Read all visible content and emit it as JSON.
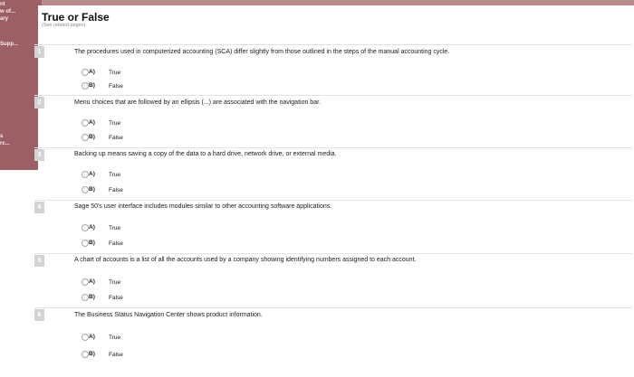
{
  "sidebar": {
    "items": [
      "nt",
      "w of...",
      "ary",
      "Supp...",
      "s",
      "rc..."
    ]
  },
  "header": {
    "title": "True or False",
    "subtitle": "(See related pages)"
  },
  "questions": [
    {
      "num": "1",
      "text": "The procedures used in computerized accounting (SCA) differ slightly from those outlined in the steps of the manual accounting cycle.",
      "options": [
        {
          "letter": "A)",
          "label": "True"
        },
        {
          "letter": "B)",
          "label": "False"
        }
      ]
    },
    {
      "num": "2",
      "text": "Menu choices that are followed by an ellipsis (...) are associated with the navigation bar.",
      "options": [
        {
          "letter": "A)",
          "label": "True"
        },
        {
          "letter": "B)",
          "label": "False"
        }
      ]
    },
    {
      "num": "3",
      "text": "Backing up means saving a copy of the data to a hard drive, network drive, or external media.",
      "options": [
        {
          "letter": "A)",
          "label": "True"
        },
        {
          "letter": "B)",
          "label": "False"
        }
      ]
    },
    {
      "num": "4",
      "text": "Sage 50's user interface includes modules similar to other accounting software applications.",
      "options": [
        {
          "letter": "A)",
          "label": "True"
        },
        {
          "letter": "B)",
          "label": "False"
        }
      ]
    },
    {
      "num": "5",
      "text": "A chart of accounts is a list of all the accounts used by a company showing identifying numbers assigned to each account.",
      "options": [
        {
          "letter": "A)",
          "label": "True"
        },
        {
          "letter": "B)",
          "label": "False"
        }
      ]
    },
    {
      "num": "6",
      "text": "The Business Status Navigation Center shows product information.",
      "options": [
        {
          "letter": "A)",
          "label": "True"
        },
        {
          "letter": "B)",
          "label": "False"
        }
      ]
    }
  ]
}
